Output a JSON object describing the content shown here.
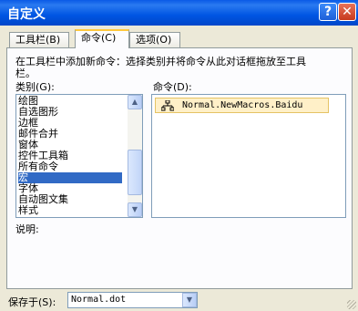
{
  "window": {
    "title": "自定义",
    "help_button": "?",
    "close_button": "✕"
  },
  "tabs": [
    {
      "label": "工具栏(B)",
      "active": false
    },
    {
      "label": "命令(C)",
      "active": true
    },
    {
      "label": "选项(O)",
      "active": false
    }
  ],
  "instructions": {
    "line1": "在工具栏中添加新命令：选择类别并将命令从此对话框拖放至工具",
    "line2": "栏。"
  },
  "categories": {
    "label": "类别(G):",
    "items": [
      "绘图",
      "自选图形",
      "边框",
      "邮件合并",
      "窗体",
      "控件工具箱",
      "所有命令",
      "宏",
      "字体",
      "自动图文集",
      "样式"
    ],
    "selected_index": 7
  },
  "commands": {
    "label": "命令(D):",
    "items": [
      "Normal.NewMacros.Baidu"
    ]
  },
  "description": {
    "label": "说明:"
  },
  "save_in": {
    "label": "保存于(S):",
    "value": "Normal.dot"
  },
  "icons": {
    "help": "question-icon",
    "close": "close-icon",
    "macro": "macro-icon",
    "scroll_up": "up-arrow-icon",
    "scroll_down": "down-arrow-icon",
    "dropdown": "chevron-down-icon"
  }
}
